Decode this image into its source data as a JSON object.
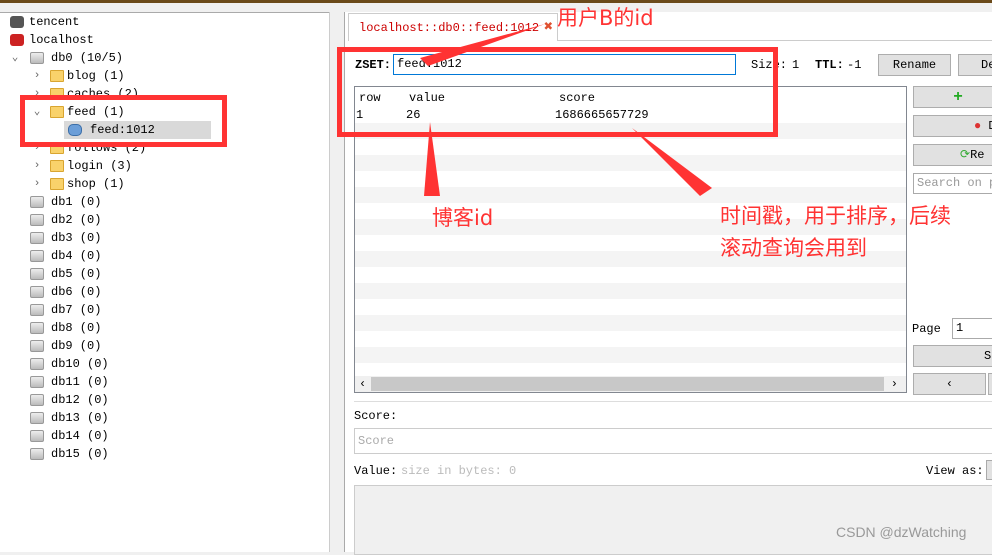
{
  "tree": {
    "connections": [
      {
        "label": "tencent"
      },
      {
        "label": "localhost"
      }
    ],
    "db0": {
      "label": "db0  (10/5)"
    },
    "folders": [
      {
        "label": "blog (1)"
      },
      {
        "label": "caches (2)"
      },
      {
        "label": "feed (1)"
      },
      {
        "label": "follows (2)"
      },
      {
        "label": "login (3)"
      },
      {
        "label": "shop (1)"
      }
    ],
    "selected_key": "feed:1012",
    "dbs": [
      "db1 (0)",
      "db2 (0)",
      "db3 (0)",
      "db4 (0)",
      "db5 (0)",
      "db6 (0)",
      "db7 (0)",
      "db8 (0)",
      "db9 (0)",
      "db10 (0)",
      "db11 (0)",
      "db12 (0)",
      "db13 (0)",
      "db14 (0)",
      "db15 (0)"
    ]
  },
  "tab": {
    "label": "localhost::db0::feed:1012"
  },
  "key": {
    "type_label": "ZSET:",
    "name": "feed:1012",
    "size_label": "Size:",
    "size": "1",
    "ttl_label": "TTL:",
    "ttl": "-1",
    "rename": "Rename",
    "delete": "De"
  },
  "table": {
    "columns": [
      "row",
      "value",
      "score"
    ],
    "rows": [
      [
        "1",
        "26",
        "1686665657729"
      ]
    ]
  },
  "side": {
    "add": "+",
    "delete": "D",
    "reload": "Re",
    "search_placeholder": "Search on p",
    "page_label": "Page",
    "page": "1",
    "set": "S",
    "prev": "‹"
  },
  "score": {
    "label": "Score:",
    "placeholder": "Score"
  },
  "value": {
    "label": "Value:",
    "size": "size in bytes: 0",
    "view_as": "View as:"
  },
  "annotations": {
    "user": "用户B的id",
    "blog": "博客id",
    "ts1": "时间戳，用于排序，后续",
    "ts2": "滚动查询会用到",
    "color": "#ff3333"
  },
  "watermark": "CSDN @dzWatching"
}
